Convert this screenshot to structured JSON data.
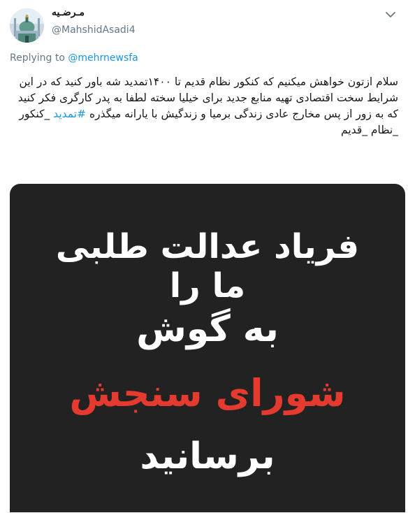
{
  "tweet": {
    "display_name": "مـرضـیه",
    "handle": "@MahshidAsadi4",
    "replying_to_prefix": "Replying to",
    "replying_to_handle": "@mehrnewsfa",
    "body_text": "سلام ازتون خواهش میکنیم که کنکور نظام قدیم تا ۱۴۰۰تمدید شه باور کنید که در این شرایط سخت اقتصادی تهیه منابع جدید برای خیلیا سخته لطفا به پدر کارگری فکر کنید که به زور از پس مخارج عادی زندگی برمیا و زندگیش با یارانه میگذره ",
    "hashtag": "#تمدید",
    "body_tail": " _کنکور _نظام _قدیم",
    "more_icon": "chevron-down-icon"
  },
  "media": {
    "background": "#222222",
    "lines": [
      {
        "text": "فریاد عدالت طلبی",
        "color": "#ffffff"
      },
      {
        "text": "ما را",
        "color": "#ffffff"
      },
      {
        "text": "به گوش",
        "color": "#ffffff"
      },
      {
        "text": "شورای سنجش",
        "color": "#e53a2f"
      },
      {
        "text": "برسانید",
        "color": "#ffffff"
      }
    ]
  }
}
